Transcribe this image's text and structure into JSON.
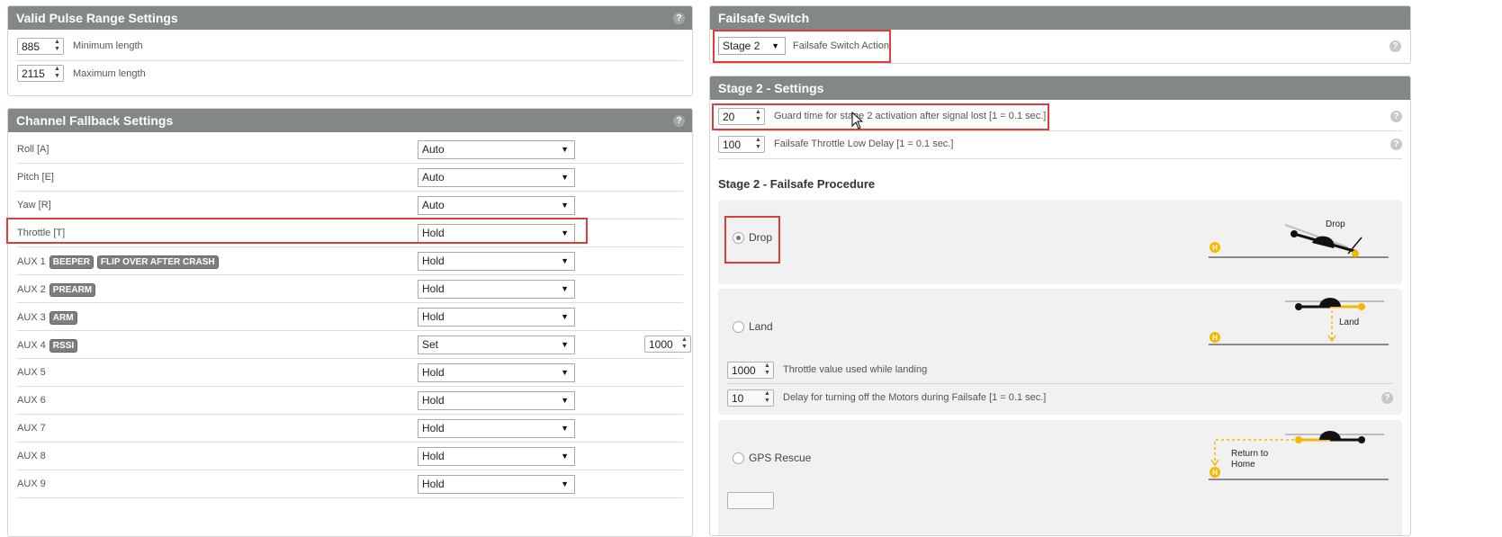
{
  "valid_pulse": {
    "title": "Valid Pulse Range Settings",
    "min_value": "885",
    "min_label": "Minimum length",
    "max_value": "2115",
    "max_label": "Maximum length"
  },
  "fallback": {
    "title": "Channel Fallback Settings",
    "rows": [
      {
        "label": "Roll [A]",
        "value": "Auto"
      },
      {
        "label": "Pitch [E]",
        "value": "Auto"
      },
      {
        "label": "Yaw [R]",
        "value": "Auto"
      },
      {
        "label": "Throttle [T]",
        "value": "Hold"
      },
      {
        "label": "AUX 1",
        "tags": [
          "BEEPER",
          "FLIP OVER AFTER CRASH"
        ],
        "value": "Hold"
      },
      {
        "label": "AUX 2",
        "tags": [
          "PREARM"
        ],
        "value": "Hold"
      },
      {
        "label": "AUX 3",
        "tags": [
          "ARM"
        ],
        "value": "Hold"
      },
      {
        "label": "AUX 4",
        "tags": [
          "RSSI"
        ],
        "value": "Set",
        "set_value": "1000"
      },
      {
        "label": "AUX 5",
        "value": "Hold"
      },
      {
        "label": "AUX 6",
        "value": "Hold"
      },
      {
        "label": "AUX 7",
        "value": "Hold"
      },
      {
        "label": "AUX 8",
        "value": "Hold"
      },
      {
        "label": "AUX 9",
        "value": "Hold"
      }
    ]
  },
  "failsafe_switch": {
    "title": "Failsafe Switch",
    "action_value": "Stage 2",
    "action_label": "Failsafe Switch Action"
  },
  "stage2": {
    "title": "Stage 2 - Settings",
    "guard_value": "20",
    "guard_label": "Guard time for stage 2 activation after signal lost [1 = 0.1 sec.]",
    "throttle_low_value": "100",
    "throttle_low_label": "Failsafe Throttle Low Delay [1 = 0.1 sec.]",
    "procedure_title": "Stage 2 - Failsafe Procedure",
    "drop_label": "Drop",
    "drop_diagram_label": "Drop",
    "land_label": "Land",
    "land_diagram_label": "Land",
    "land_throttle_value": "1000",
    "land_throttle_label": "Throttle value used while landing",
    "land_delay_value": "10",
    "land_delay_label": "Delay for turning off the Motors during Failsafe [1 = 0.1 sec.]",
    "gps_label": "GPS Rescue",
    "gps_diagram_line1": "Return to",
    "gps_diagram_line2": "Home",
    "home_marker": "H"
  },
  "help_glyph": "?",
  "colors": {
    "header": "#828885",
    "highlight": "#e03c3c",
    "accent": "#f5b800"
  }
}
